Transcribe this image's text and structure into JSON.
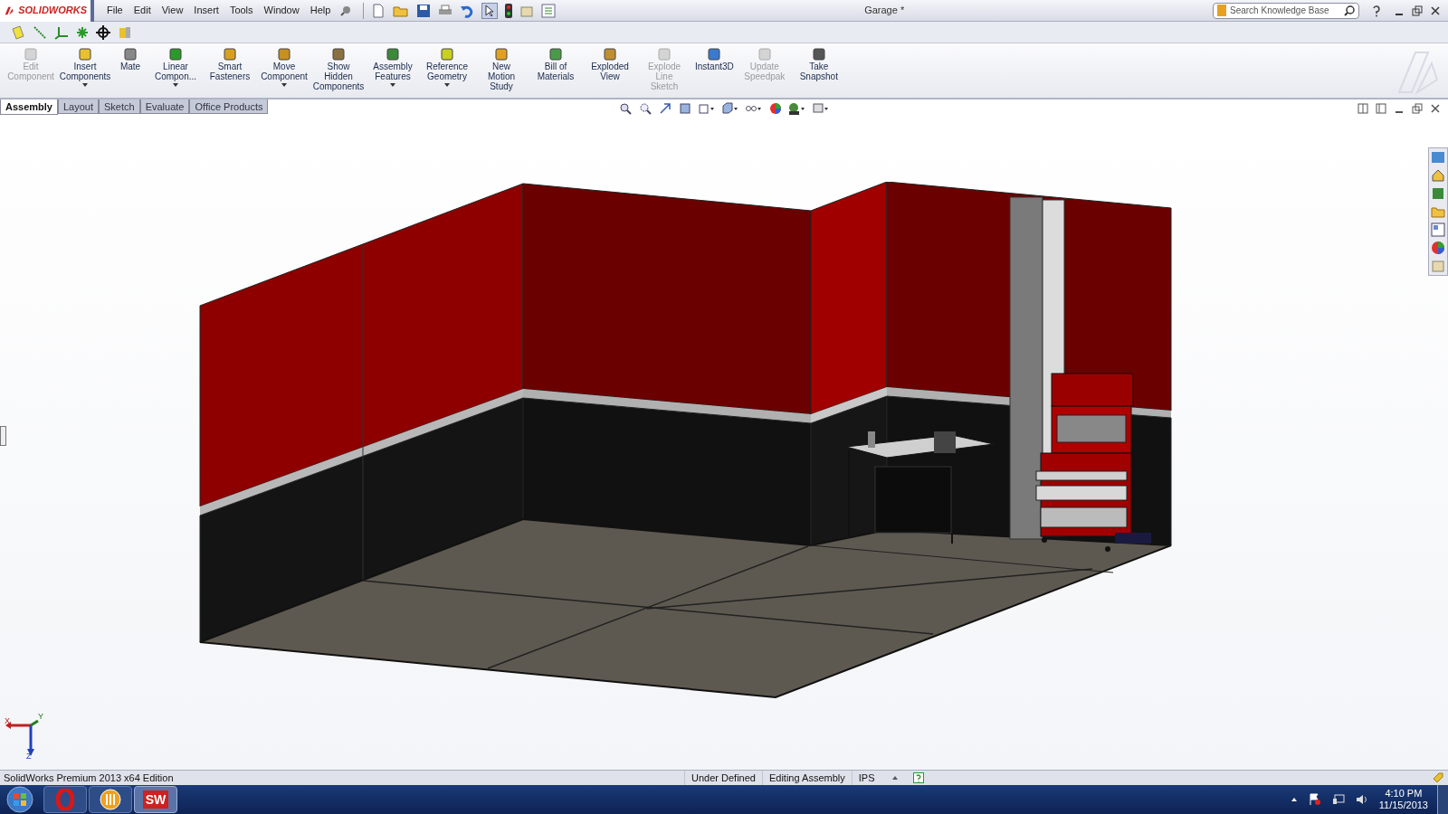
{
  "app": {
    "logo": "SOLIDWORKS",
    "menu": [
      "File",
      "Edit",
      "View",
      "Insert",
      "Tools",
      "Window",
      "Help"
    ],
    "document_title": "Garage *",
    "search": {
      "placeholder": "Search Knowledge Base"
    }
  },
  "ribbon": {
    "commands": [
      {
        "label": "Edit Component",
        "disabled": true,
        "dropdown": false
      },
      {
        "label": "Insert Components",
        "disabled": false,
        "dropdown": true
      },
      {
        "label": "Mate",
        "disabled": false,
        "dropdown": false
      },
      {
        "label": "Linear Compon...",
        "disabled": false,
        "dropdown": true
      },
      {
        "label": "Smart Fasteners",
        "disabled": false,
        "dropdown": false
      },
      {
        "label": "Move Component",
        "disabled": false,
        "dropdown": true
      },
      {
        "label": "Show Hidden Components",
        "disabled": false,
        "dropdown": false
      },
      {
        "label": "Assembly Features",
        "disabled": false,
        "dropdown": true
      },
      {
        "label": "Reference Geometry",
        "disabled": false,
        "dropdown": true
      },
      {
        "label": "New Motion Study",
        "disabled": false,
        "dropdown": false
      },
      {
        "label": "Bill of Materials",
        "disabled": false,
        "dropdown": false
      },
      {
        "label": "Exploded View",
        "disabled": false,
        "dropdown": false
      },
      {
        "label": "Explode Line Sketch",
        "disabled": true,
        "dropdown": false
      },
      {
        "label": "Instant3D",
        "disabled": false,
        "dropdown": false
      },
      {
        "label": "Update Speedpak",
        "disabled": true,
        "dropdown": false
      },
      {
        "label": "Take Snapshot",
        "disabled": false,
        "dropdown": false
      }
    ]
  },
  "tabs": [
    {
      "label": "Assembly",
      "selected": true
    },
    {
      "label": "Layout",
      "selected": false
    },
    {
      "label": "Sketch",
      "selected": false
    },
    {
      "label": "Evaluate",
      "selected": false
    },
    {
      "label": "Office Products",
      "selected": false
    }
  ],
  "triad": {
    "labels": [
      "X",
      "Y",
      "Z"
    ]
  },
  "status_bar": {
    "edition": "SolidWorks Premium 2013 x64 Edition",
    "items": [
      "Under Defined",
      "Editing Assembly",
      "IPS"
    ]
  },
  "taskbar": {
    "app_label": "SW",
    "time": "4:10 PM",
    "date": "11/15/2013"
  }
}
